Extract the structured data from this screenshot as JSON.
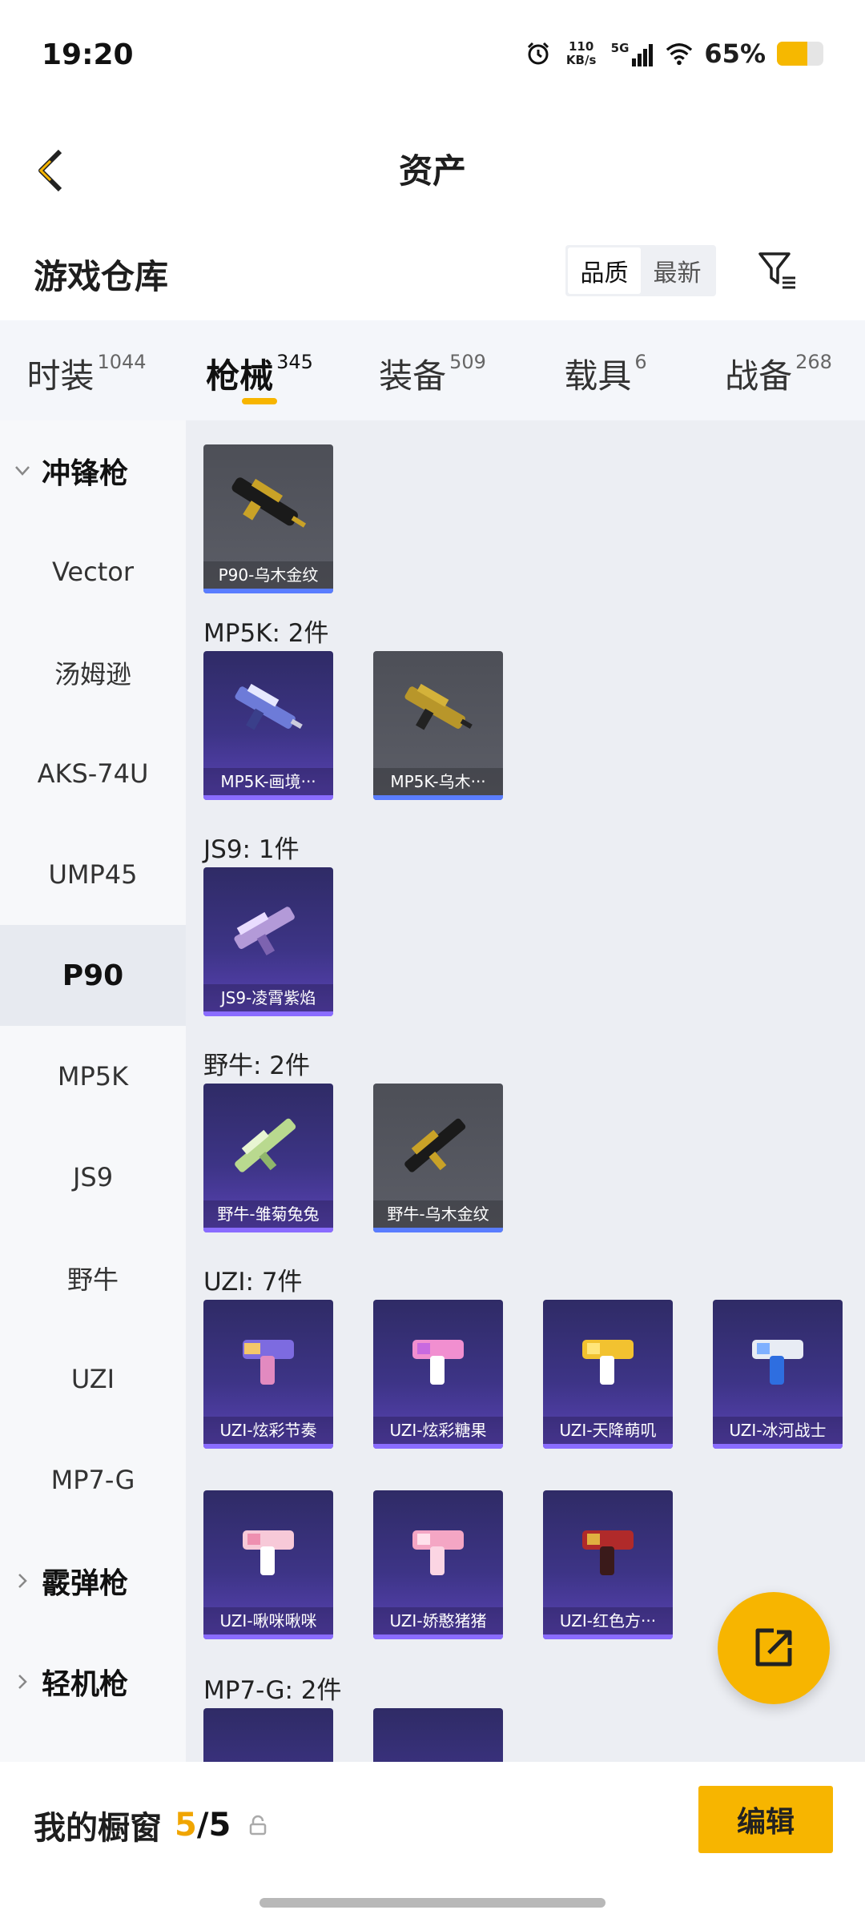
{
  "status": {
    "time": "19:20",
    "speed_top": "110",
    "speed_bottom": "KB/s",
    "network": "5G",
    "battery_text": "65%",
    "battery_level": 0.65
  },
  "header": {
    "title": "资产"
  },
  "warehouse": {
    "title": "游戏仓库",
    "sort_options": [
      "品质",
      "最新"
    ],
    "sort_selected": "品质"
  },
  "tabs": [
    {
      "label": "时装",
      "count": "1044"
    },
    {
      "label": "枪械",
      "count": "345"
    },
    {
      "label": "装备",
      "count": "509"
    },
    {
      "label": "载具",
      "count": "6"
    },
    {
      "label": "战备",
      "count": "268"
    }
  ],
  "sidebar": {
    "group_open": "冲锋枪",
    "items": [
      "Vector",
      "汤姆逊",
      "AKS-74U",
      "UMP45",
      "P90",
      "MP5K",
      "JS9",
      "野牛",
      "UZI",
      "MP7-G"
    ],
    "selected": "P90",
    "groups_closed": [
      "霰弹枪",
      "轻机枪"
    ]
  },
  "sections": [
    {
      "title": "",
      "items": [
        {
          "name": "P90-乌木金纹"
        }
      ]
    },
    {
      "title": "MP5K: 2件",
      "items": [
        {
          "name": "MP5K-画境···"
        },
        {
          "name": "MP5K-乌木···"
        }
      ]
    },
    {
      "title": "JS9: 1件",
      "items": [
        {
          "name": "JS9-凌霄紫焰"
        }
      ]
    },
    {
      "title": "野牛: 2件",
      "items": [
        {
          "name": "野牛-雏菊兔兔"
        },
        {
          "name": "野牛-乌木金纹"
        }
      ]
    },
    {
      "title": "UZI: 7件",
      "items": [
        {
          "name": "UZI-炫彩节奏"
        },
        {
          "name": "UZI-炫彩糖果"
        },
        {
          "name": "UZI-天降萌叽"
        },
        {
          "name": "UZI-冰河战士"
        },
        {
          "name": "UZI-啾咪啾咪"
        },
        {
          "name": "UZI-娇憨猪猪"
        },
        {
          "name": "UZI-红色方···"
        }
      ]
    },
    {
      "title": "MP7-G: 2件",
      "items": []
    }
  ],
  "bottom": {
    "showcase_label": "我的橱窗",
    "showcase_used": "5",
    "showcase_total": "/5",
    "edit_label": "编辑"
  },
  "colors": {
    "accent": "#f7b500",
    "card_purple": "#3d3486",
    "card_gray": "#55575f"
  }
}
